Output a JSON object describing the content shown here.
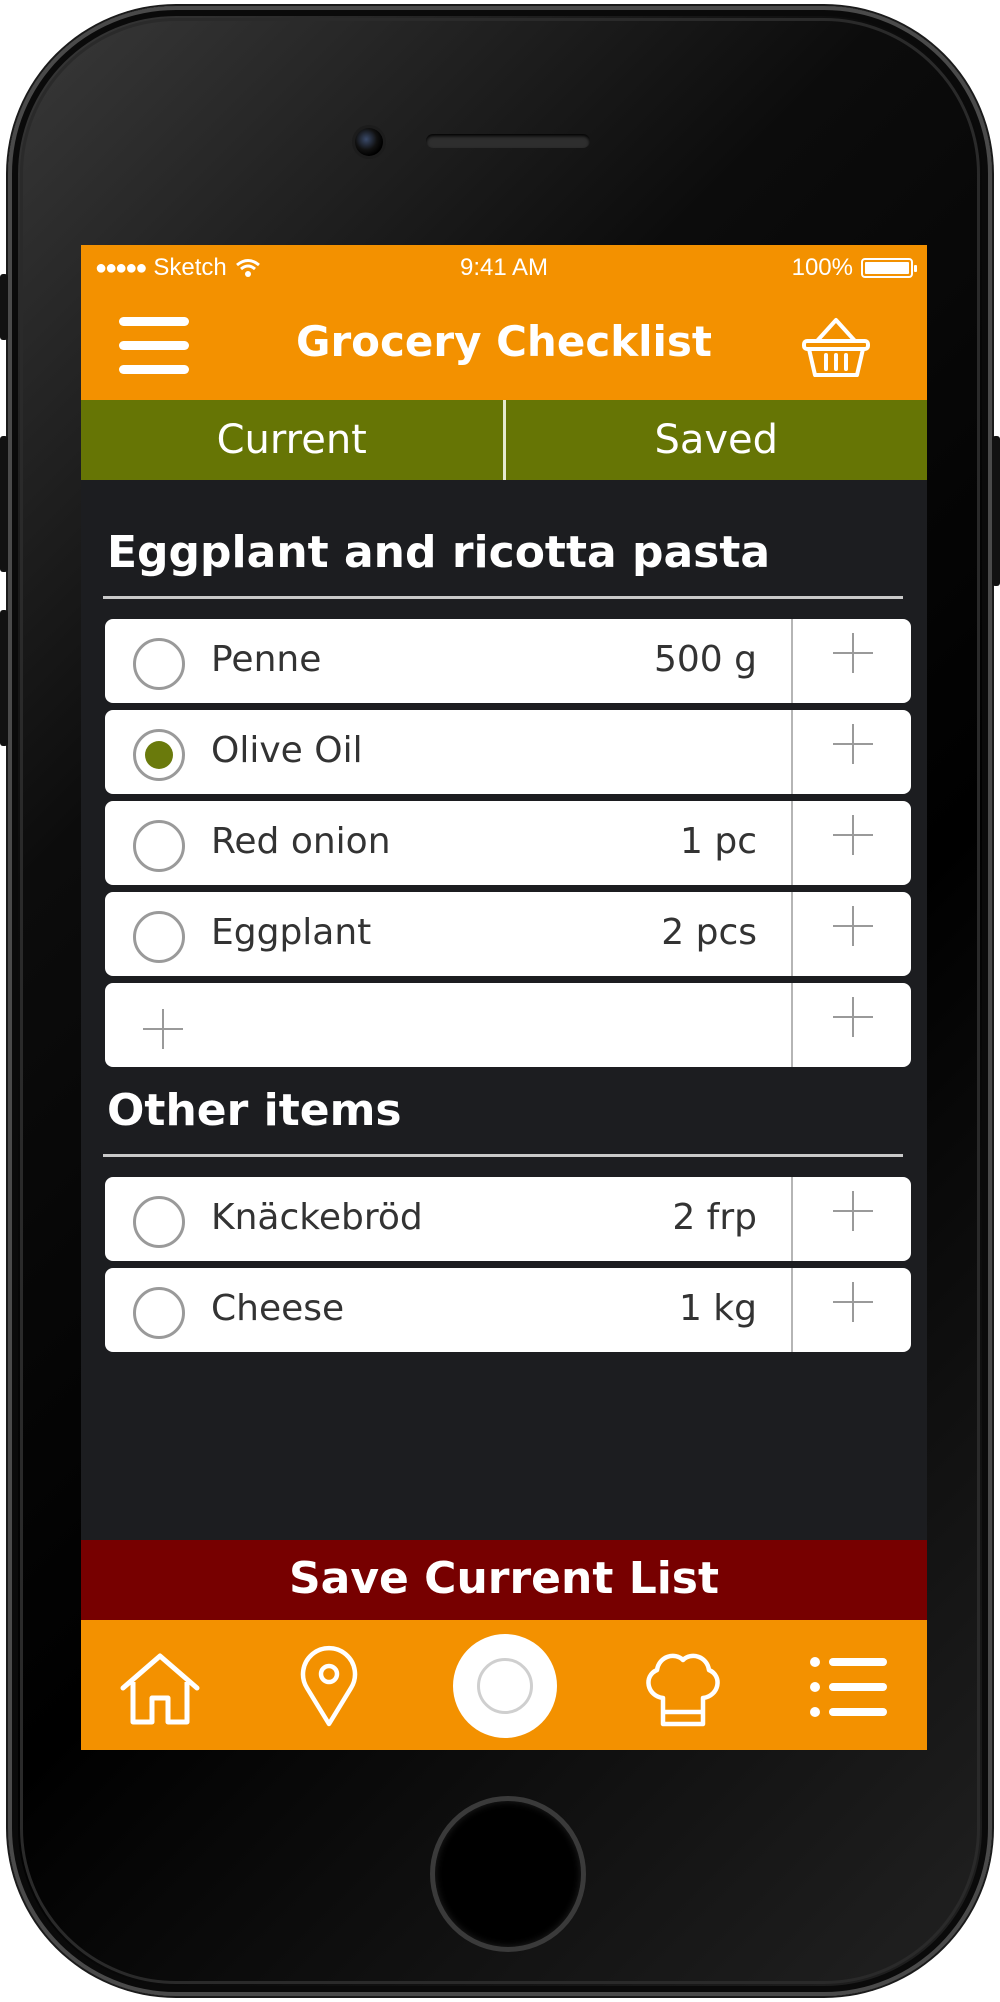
{
  "status_bar": {
    "signal_dots": "●●●●●",
    "carrier": "Sketch",
    "time": "9:41 AM",
    "battery": "100%"
  },
  "header": {
    "title": "Grocery Checklist",
    "menu_icon": "hamburger-menu-icon",
    "basket_icon": "shopping-basket-icon"
  },
  "tabs": [
    {
      "label": "Current",
      "active": true
    },
    {
      "label": "Saved",
      "active": false
    }
  ],
  "sections": [
    {
      "title": "Eggplant and ricotta pasta",
      "items": [
        {
          "name": "Penne",
          "qty": "500 g",
          "checked": false
        },
        {
          "name": "Olive Oil",
          "qty": "",
          "checked": true
        },
        {
          "name": "Red onion",
          "qty": "1 pc",
          "checked": false
        },
        {
          "name": "Eggplant",
          "qty": "2 pcs",
          "checked": false
        }
      ]
    },
    {
      "title": "Other items",
      "items": [
        {
          "name": "Knäckebröd",
          "qty": "2 frp",
          "checked": false
        },
        {
          "name": "Cheese",
          "qty": "1 kg",
          "checked": false
        }
      ]
    }
  ],
  "save_button": {
    "label": "Save Current List"
  },
  "bottom_tabs": [
    "home-icon",
    "location-pin-icon",
    "record-icon",
    "chef-hat-icon",
    "list-icon"
  ],
  "colors": {
    "header_orange": "#f39100",
    "tab_green": "#667505",
    "save_red": "#770000",
    "check_green": "#6a7a0c",
    "background": "#1c1d20"
  }
}
